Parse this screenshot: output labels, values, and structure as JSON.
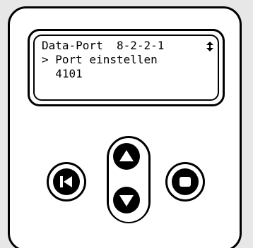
{
  "display": {
    "line1": "Data-Port  8-2-2-1",
    "line2": "> Port einstellen",
    "line3": "  4101"
  },
  "icons": {
    "scroll": "up-down-arrow-icon",
    "back": "skip-back-icon",
    "up": "arrow-up-icon",
    "down": "arrow-down-icon",
    "enter": "stop-square-icon"
  },
  "colors": {
    "ink": "#000000",
    "panel": "#ffffff",
    "background": "#e7e7e7"
  }
}
